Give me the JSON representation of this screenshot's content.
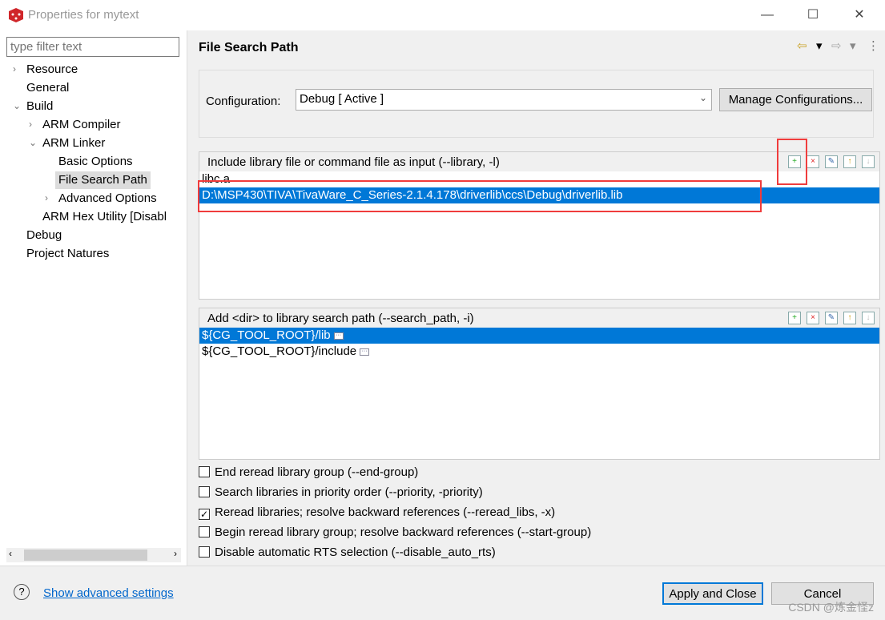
{
  "window": {
    "title": "Properties for mytext",
    "minimize": "—",
    "maximize": "☐",
    "close": "✕"
  },
  "sidebar": {
    "filter_placeholder": "type filter text",
    "items": [
      {
        "label": "Resource",
        "expand": "›"
      },
      {
        "label": "General"
      },
      {
        "label": "Build",
        "expand": "⌄"
      },
      {
        "label": "ARM Compiler",
        "expand": "›"
      },
      {
        "label": "ARM Linker",
        "expand": "⌄"
      },
      {
        "label": "Basic Options"
      },
      {
        "label": "File Search Path",
        "selected": true
      },
      {
        "label": "Advanced Options",
        "expand": "›"
      },
      {
        "label": "ARM Hex Utility  [Disabl"
      },
      {
        "label": "Debug"
      },
      {
        "label": "Project Natures"
      }
    ]
  },
  "page": {
    "title": "File Search Path",
    "nav": {
      "back": "⇦",
      "fwd": "⇨",
      "dd": "▾",
      "menu": "⋮"
    },
    "configuration": {
      "label": "Configuration:",
      "value": "Debug  [ Active ]",
      "manage_button": "Manage Configurations..."
    },
    "library_panel": {
      "header": "Include library file or command file as input (--library, -l)",
      "rows": [
        "libc.a",
        "D:\\MSP430\\TIVA\\TivaWare_C_Series-2.1.4.178\\driverlib\\ccs\\Debug\\driverlib.lib"
      ],
      "selected_index": 1
    },
    "search_panel": {
      "header": "Add <dir> to library search path (--search_path, -i)",
      "rows": [
        "${CG_TOOL_ROOT}/lib",
        "${CG_TOOL_ROOT}/include"
      ],
      "selected_index": 0
    },
    "tool_icons": [
      "add-icon",
      "delete-icon",
      "edit-icon",
      "move-up-icon",
      "move-down-icon"
    ],
    "checkboxes": [
      {
        "label": "End reread library group (--end-group)",
        "checked": false
      },
      {
        "label": "Search libraries in priority order (--priority, -priority)",
        "checked": false
      },
      {
        "label": "Reread libraries; resolve backward references (--reread_libs, -x)",
        "checked": true
      },
      {
        "label": "Begin reread library group; resolve backward references (--start-group)",
        "checked": false
      },
      {
        "label": "Disable automatic RTS selection (--disable_auto_rts)",
        "checked": false
      }
    ]
  },
  "footer": {
    "help": "?",
    "advanced_link": "Show advanced settings",
    "apply_button": "Apply and Close",
    "cancel_button": "Cancel",
    "watermark": "CSDN @炼金怪z"
  },
  "colors": {
    "selection": "#0078d7",
    "annotation": "#f03c3c",
    "link": "#0066cc"
  }
}
